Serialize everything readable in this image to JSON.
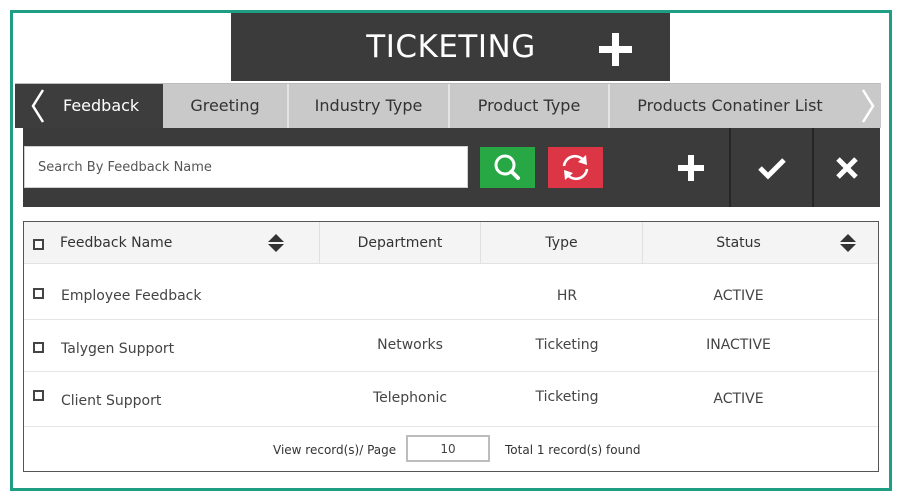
{
  "header": {
    "title": "TICKETING",
    "add_icon": "plus-icon"
  },
  "tabs": [
    {
      "label": "Feedback",
      "active": true
    },
    {
      "label": "Greeting",
      "active": false
    },
    {
      "label": "Industry Type",
      "active": false
    },
    {
      "label": "Product Type",
      "active": false
    },
    {
      "label": "Products Conatiner List",
      "active": false
    }
  ],
  "toolbar": {
    "search_placeholder": "Search By Feedback Name",
    "search_icon": "search-icon",
    "refresh_icon": "refresh-icon",
    "add_icon": "plus-icon",
    "confirm_icon": "check-icon",
    "close_icon": "close-icon"
  },
  "table": {
    "columns": [
      "Feedback Name",
      "Department",
      "Type",
      "Status"
    ],
    "rows": [
      {
        "name": "Employee Feedback",
        "department": "",
        "type": "HR",
        "status": "ACTIVE"
      },
      {
        "name": "Talygen Support",
        "department": "Networks",
        "type": "Ticketing",
        "status": "INACTIVE"
      },
      {
        "name": "Client Support",
        "department": "Telephonic",
        "type": "Ticketing",
        "status": "ACTIVE"
      }
    ]
  },
  "footer": {
    "page_size_label": "View record(s)/ Page",
    "page_size_value": "10",
    "total_label": "Total 1 record(s) found"
  },
  "colors": {
    "frame": "#1f9e83",
    "dark": "#3b3b3b",
    "search_button": "#27a844",
    "refresh_button": "#dc3545"
  }
}
